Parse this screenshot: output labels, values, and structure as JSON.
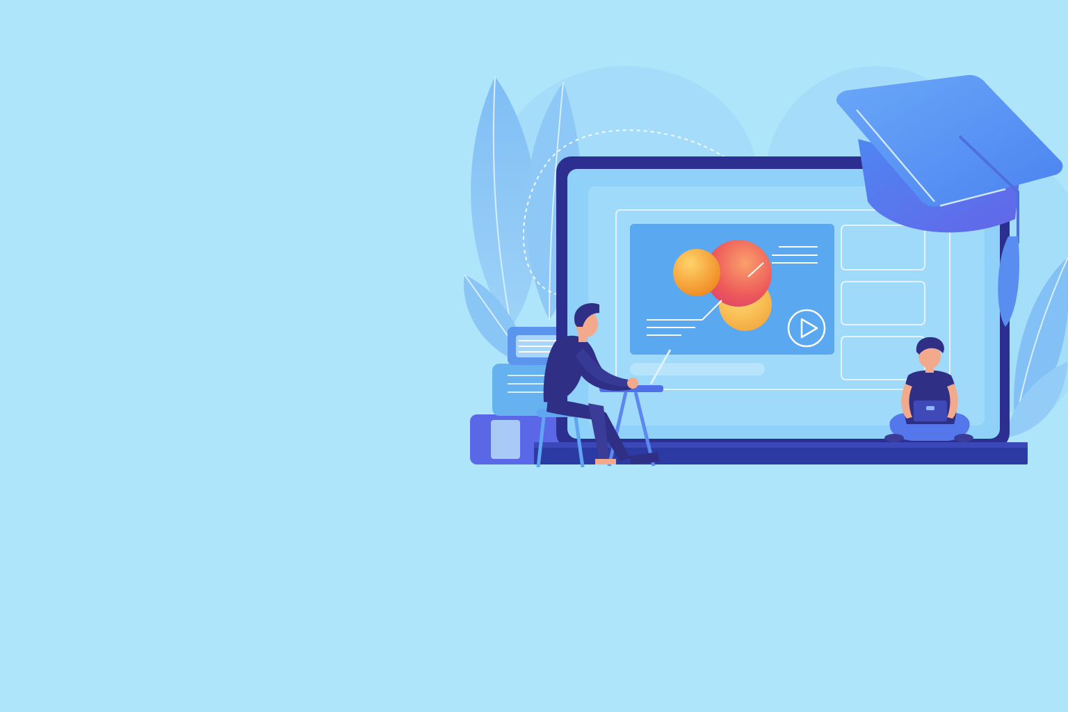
{
  "colors": {
    "background": "#aee5fb",
    "leaf_light": "#8fcdf5",
    "leaf_mid": "#74b6f0",
    "laptop_frame": "#2c2f8f",
    "laptop_screen": "#8fd1f8",
    "video_panel": "#5aa9f0",
    "cap_blue": "#4f7ff0",
    "person_navy": "#2e2f85",
    "skin": "#f3a98b",
    "sphere_orange": "#f5a33a",
    "sphere_red": "#ee5a5a",
    "sphere_yellow": "#f8c64a"
  },
  "icons": {
    "play": "play-icon",
    "cap": "graduation-cap-icon"
  }
}
